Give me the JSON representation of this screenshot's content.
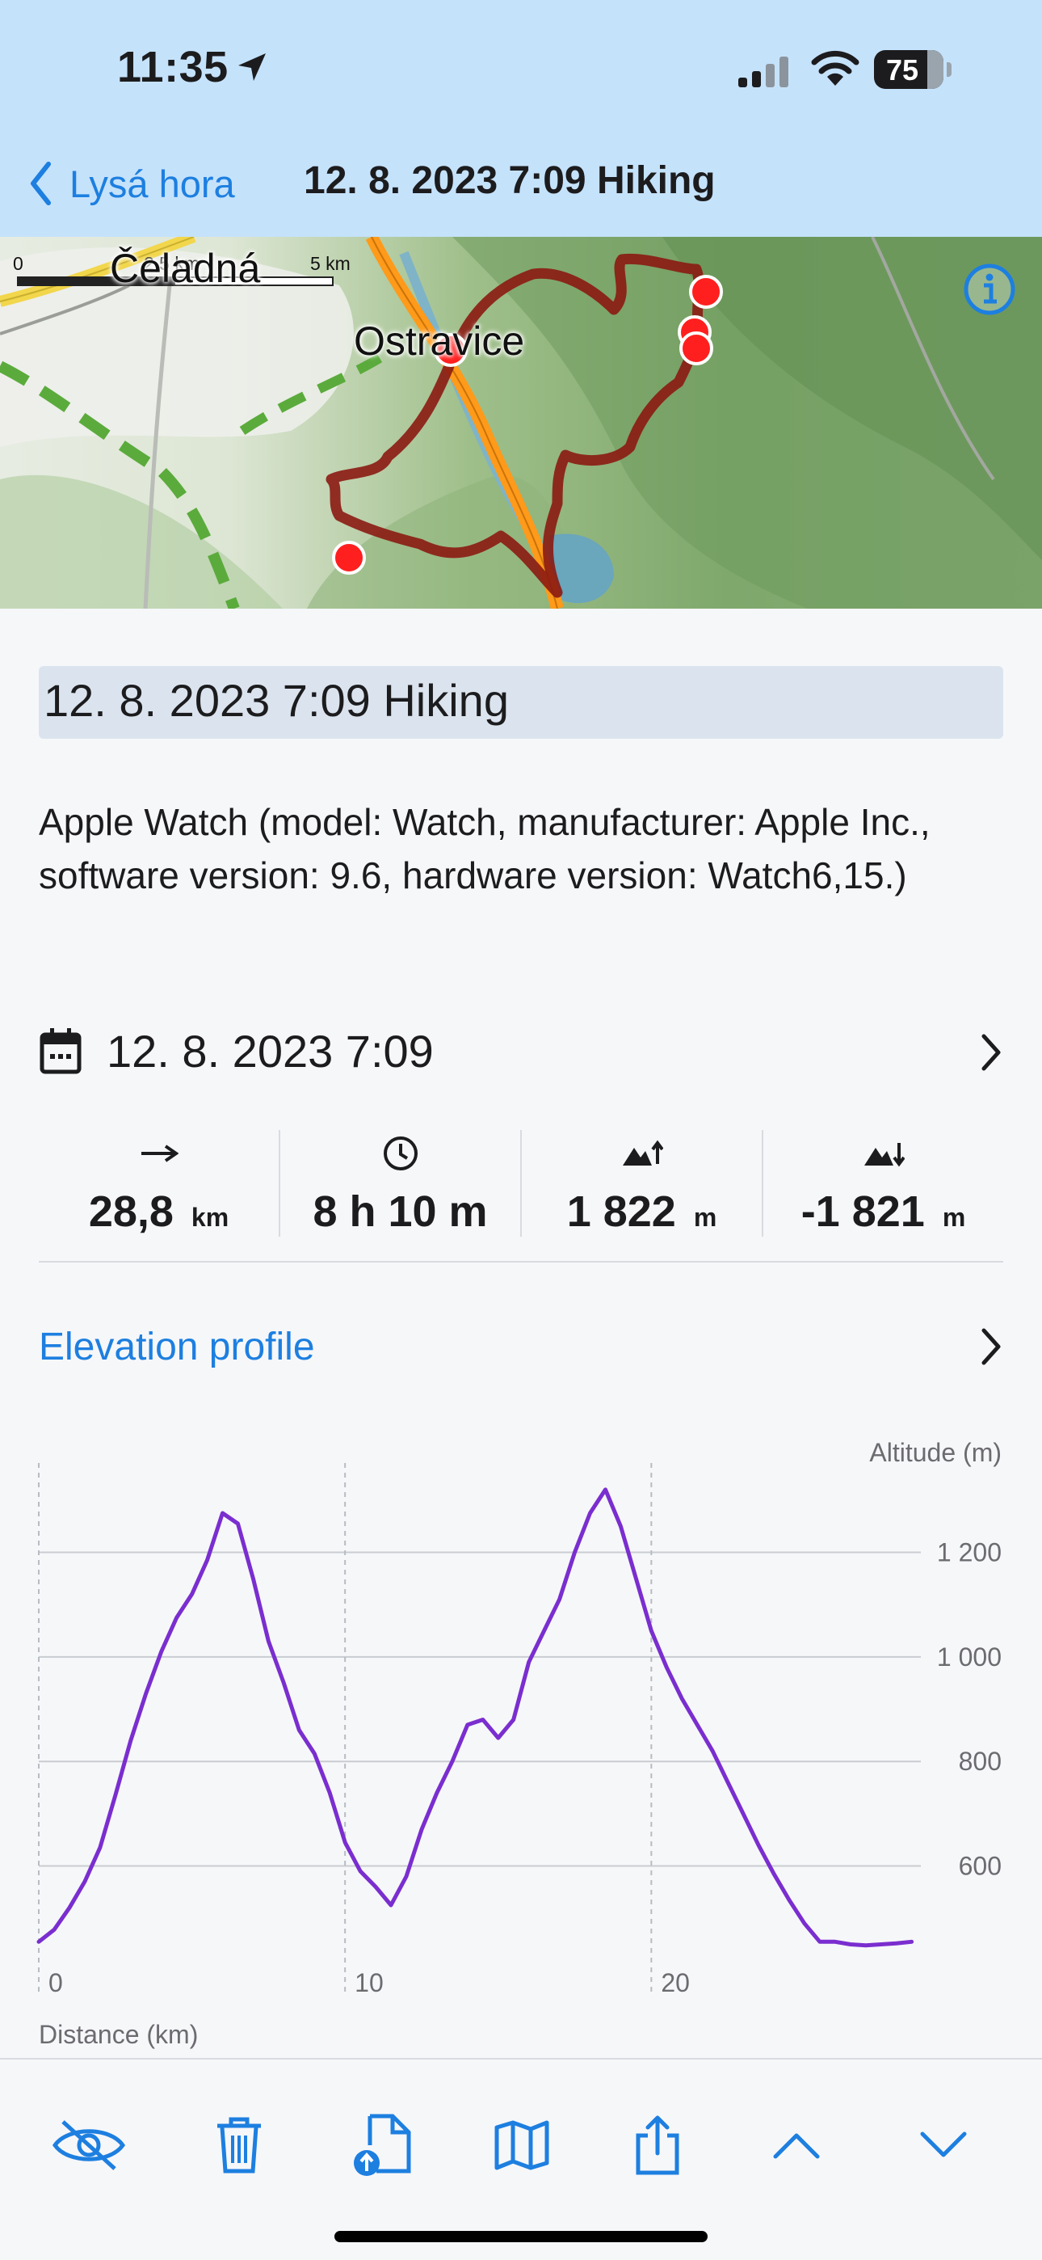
{
  "status_bar": {
    "time": "11:35",
    "battery": "75"
  },
  "nav": {
    "back_label": "Lysá hora",
    "title": "12. 8. 2023 7:09 Hiking"
  },
  "map": {
    "scale_labels": [
      "0",
      "2,5 km",
      "5 km"
    ],
    "place_labels": [
      "Čeladná",
      "Ostravice"
    ],
    "track_color": "#8b1a12",
    "marker_color": "#ff1f1f"
  },
  "activity": {
    "title": "12. 8. 2023 7:09 Hiking",
    "description": "Apple Watch (model: Watch, manufacturer: Apple Inc., software version: 9.6, hardware version: Watch6,15.)",
    "date": "12. 8. 2023 7:09"
  },
  "stats": [
    {
      "icon": "distance-arrow-icon",
      "value": "28,8",
      "unit": "km"
    },
    {
      "icon": "clock-icon",
      "value": "8 h 10 m",
      "unit": ""
    },
    {
      "icon": "ascent-icon",
      "value": "1 822",
      "unit": "m"
    },
    {
      "icon": "descent-icon",
      "value": "-1 821",
      "unit": "m"
    }
  ],
  "elevation_link": "Elevation profile",
  "chart_data": {
    "type": "line",
    "xlabel": "Distance (km)",
    "ylabel": "Altitude (m)",
    "xlim": [
      0,
      28.8
    ],
    "ylim": [
      440,
      1340
    ],
    "x_ticks": [
      0,
      10,
      20
    ],
    "y_ticks": [
      600,
      800,
      1000,
      1200
    ],
    "y_tick_labels": [
      "600",
      "800",
      "1 000",
      "1 200"
    ],
    "line_color": "#7a2ecf",
    "x": [
      0,
      0.5,
      1,
      1.5,
      2,
      2.5,
      3,
      3.5,
      4,
      4.5,
      5,
      5.5,
      6,
      6.5,
      7,
      7.5,
      8,
      8.5,
      9,
      9.5,
      10,
      10.5,
      11,
      11.5,
      12,
      12.5,
      13,
      13.5,
      14,
      14.5,
      15,
      15.5,
      16,
      16.5,
      17,
      17.5,
      18,
      18.5,
      19,
      19.5,
      20,
      20.5,
      21,
      21.5,
      22,
      22.5,
      23,
      23.5,
      24,
      24.5,
      25,
      25.5,
      26,
      26.5,
      27,
      27.5,
      28,
      28.5
    ],
    "values": [
      455,
      478,
      520,
      570,
      635,
      735,
      840,
      930,
      1010,
      1075,
      1120,
      1185,
      1275,
      1255,
      1150,
      1030,
      950,
      860,
      815,
      740,
      645,
      590,
      560,
      525,
      580,
      670,
      740,
      800,
      870,
      880,
      845,
      880,
      990,
      1050,
      1110,
      1200,
      1275,
      1320,
      1250,
      1150,
      1050,
      980,
      920,
      870,
      820,
      760,
      700,
      640,
      585,
      535,
      490,
      455,
      455,
      450,
      448,
      450,
      452,
      455
    ]
  },
  "toolbar": [
    {
      "name": "hide-button",
      "icon": "eye-slash-icon"
    },
    {
      "name": "delete-button",
      "icon": "trash-icon"
    },
    {
      "name": "export-file-button",
      "icon": "file-upload-icon"
    },
    {
      "name": "map-button",
      "icon": "map-icon"
    },
    {
      "name": "share-button",
      "icon": "share-icon"
    },
    {
      "name": "previous-button",
      "icon": "chevron-up-icon"
    },
    {
      "name": "next-button",
      "icon": "chevron-down-icon"
    }
  ],
  "colors": {
    "accent": "#1d7fe0",
    "header_bg": "#c5e2fb",
    "chart_line": "#7a2ecf"
  }
}
